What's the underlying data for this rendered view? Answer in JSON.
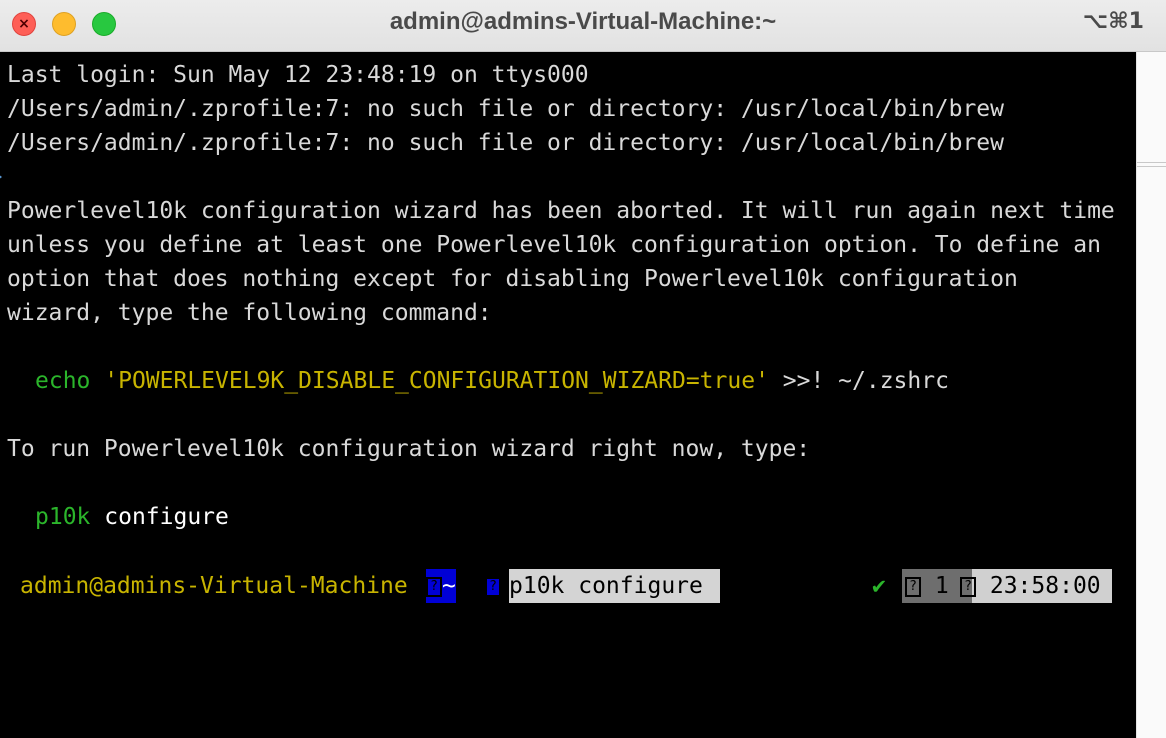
{
  "window": {
    "title": "admin@admins-Virtual-Machine:~",
    "shortcut": "⌥⌘1"
  },
  "terminal": {
    "lines": [
      "Last login: Sun May 12 23:48:19 on ttys000",
      "/Users/admin/.zprofile:7: no such file or directory: /usr/local/bin/brew",
      "/Users/admin/.zprofile:7: no such file or directory: /usr/local/bin/brew",
      "Powerlevel10k configuration wizard has been aborted. It will run again next time",
      "unless you define at least one Powerlevel10k configuration option. To define an",
      "option that does nothing except for disabling Powerlevel10k configuration",
      "wizard, type the following command:",
      "To run Powerlevel10k configuration wizard right now, type:"
    ],
    "echo_command": {
      "keyword": "echo",
      "string": "'POWERLEVEL9K_DISABLE_CONFIGURATION_WIZARD=true'",
      "rest": " >>! ~/.zshrc"
    },
    "p10k_command": {
      "keyword": "p10k",
      "arg": "configure"
    }
  },
  "prompt": {
    "user_host": "admin@admins-Virtual-Machine",
    "glyph": "?",
    "dir": "~",
    "typed_command": "p10k configure",
    "status_icon": "✔",
    "jobs": "1",
    "time": "23:58:00"
  },
  "colors": {
    "green": "#2bb52b",
    "yellow": "#c8b400",
    "dir_segment": "#0000d6",
    "input_bg": "#d4d4d4"
  }
}
